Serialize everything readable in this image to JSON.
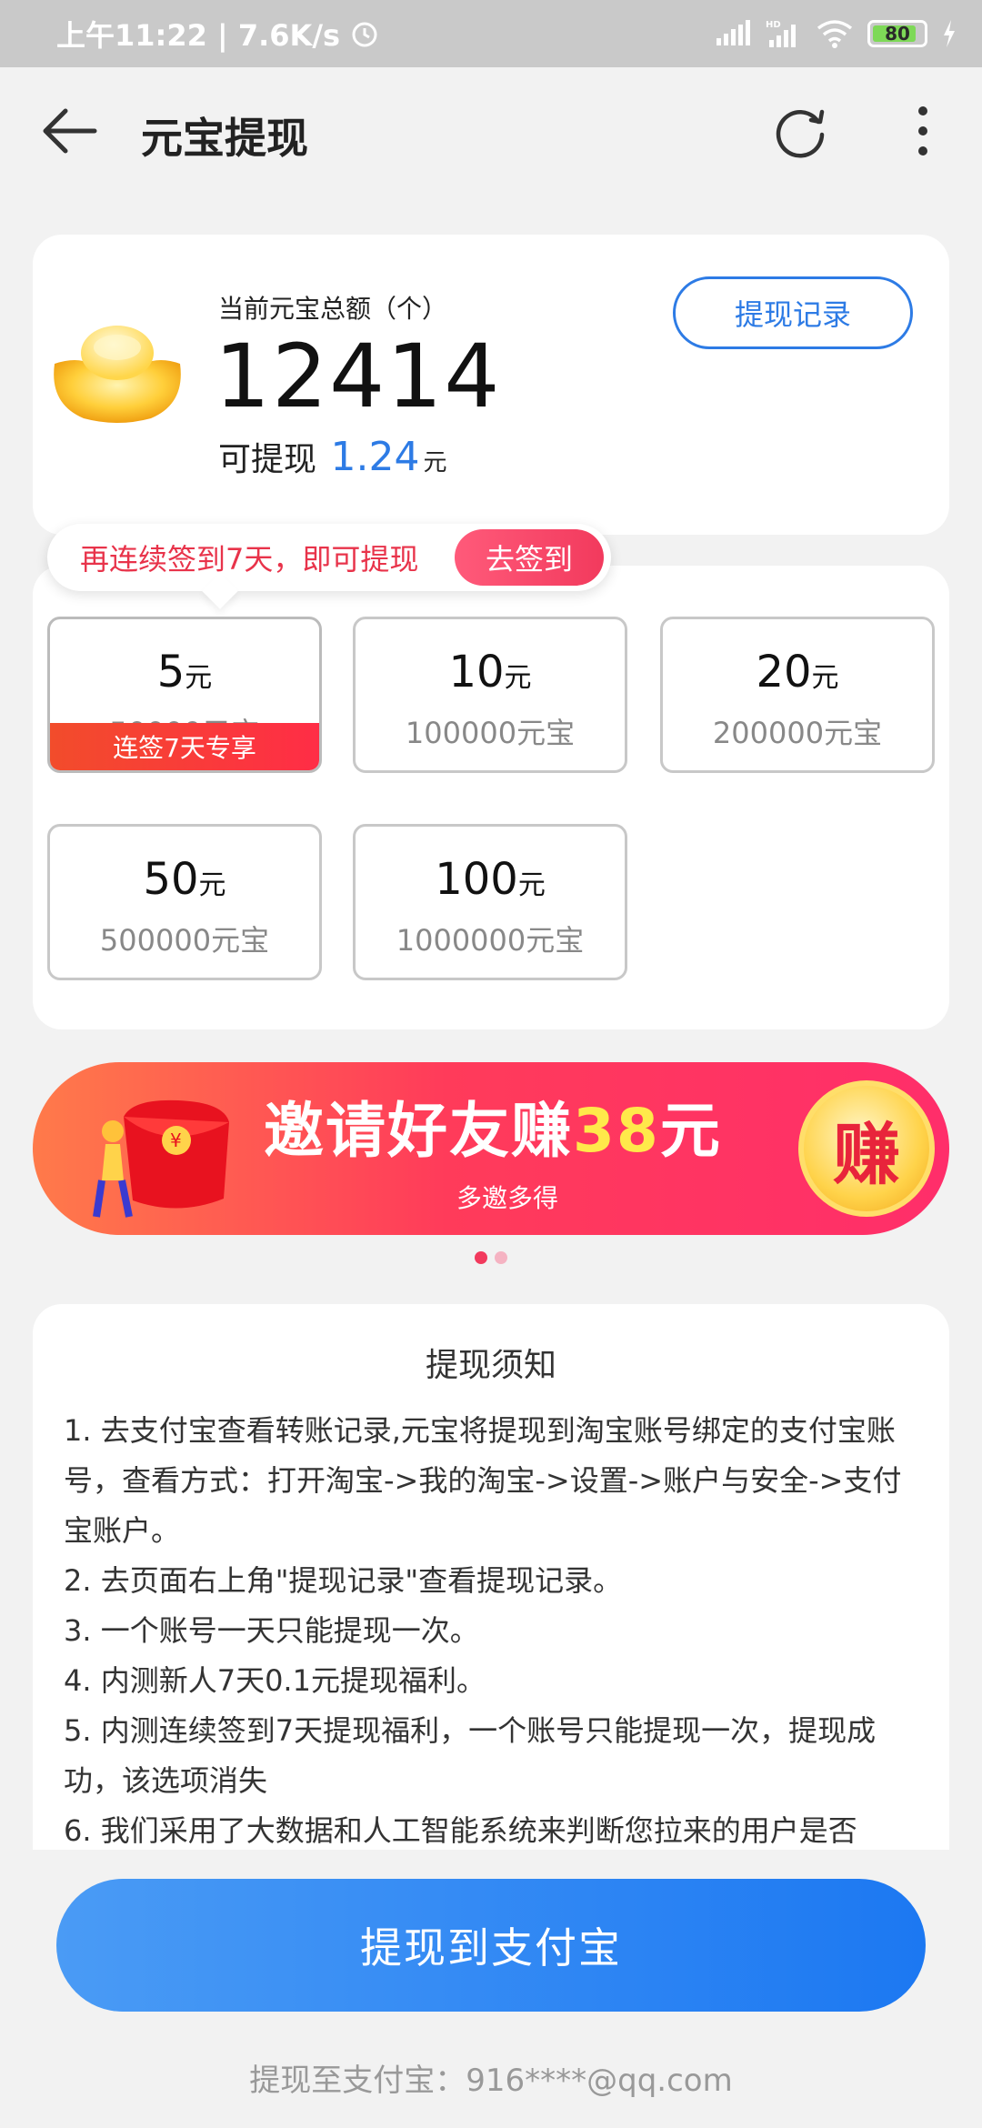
{
  "status_bar": {
    "time_speed": "上午11:22 | 7.6K/s",
    "battery": "80"
  },
  "header": {
    "title": "元宝提现"
  },
  "balance": {
    "label": "当前元宝总额（个）",
    "value": "12414",
    "withdrawable_label": "可提现",
    "withdrawable_amount": "1.24",
    "withdrawable_unit": "元",
    "record_button": "提现记录"
  },
  "tooltip": {
    "text": "再连续签到7天，即可提现",
    "button": "去签到"
  },
  "options": [
    {
      "amount": "5",
      "unit": "元",
      "coins": "50000元宝",
      "tag": "连签7天专享"
    },
    {
      "amount": "10",
      "unit": "元",
      "coins": "100000元宝"
    },
    {
      "amount": "20",
      "unit": "元",
      "coins": "200000元宝"
    },
    {
      "amount": "50",
      "unit": "元",
      "coins": "500000元宝"
    },
    {
      "amount": "100",
      "unit": "元",
      "coins": "1000000元宝"
    }
  ],
  "banner": {
    "title_pre": "邀请好友赚",
    "title_num": "38",
    "title_post": "元",
    "subtitle": "多邀多得",
    "badge": "赚"
  },
  "notice": {
    "title": "提现须知",
    "items": [
      "1. 去支付宝查看转账记录,元宝将提现到淘宝账号绑定的支付宝账号，查看方式：打开淘宝->我的淘宝->设置->账户与安全->支付宝账户。",
      "2. 去页面右上角\"提现记录\"查看提现记录。",
      "3. 一个账号一天只能提现一次。",
      "4. 内测新人7天0.1元提现福利。",
      " 5. 内测连续签到7天提现福利，一个账号只能提现一次，提现成功，该选项消失",
      "6. 我们采用了大数据和人工智能系统来判断您拉来的用户是否"
    ]
  },
  "footer": {
    "button": "提现到支付宝",
    "account": "提现至支付宝：916****@qq.com"
  },
  "colors": {
    "accent_blue": "#2d7be5",
    "accent_red": "#f23a5d"
  }
}
